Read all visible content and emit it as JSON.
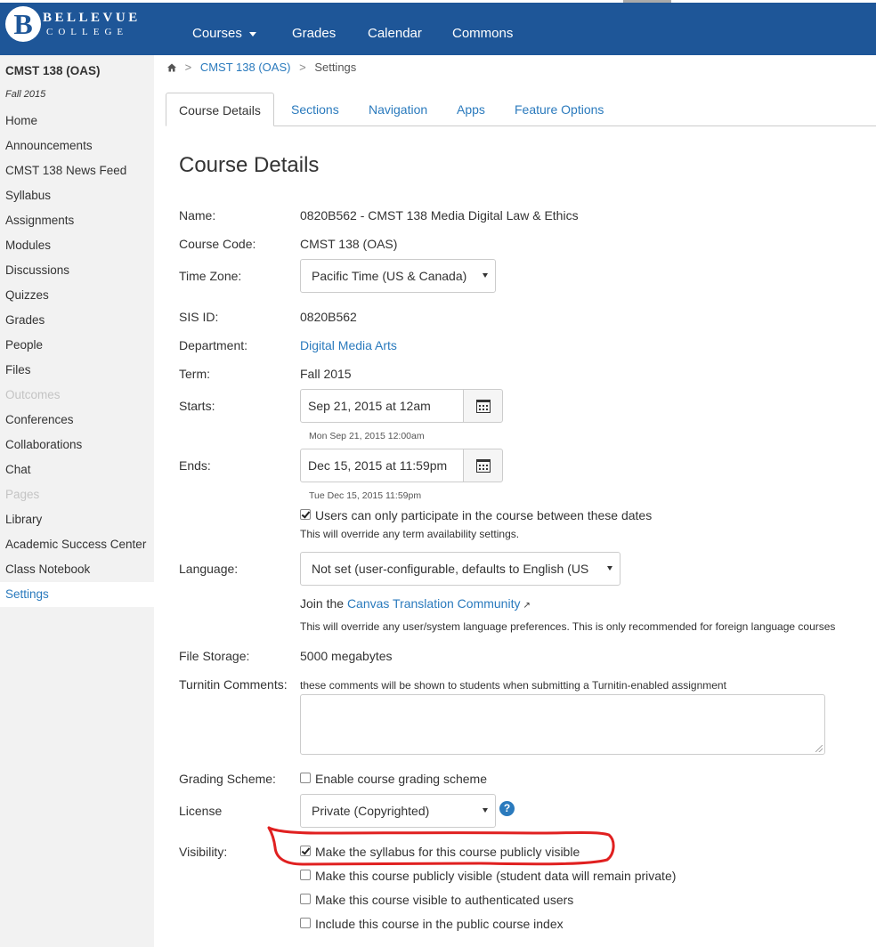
{
  "header": {
    "logo_letter": "B",
    "logo_line1": "BELLEVUE",
    "logo_line2": "COLLEGE",
    "nav": {
      "courses": "Courses",
      "grades": "Grades",
      "calendar": "Calendar",
      "commons": "Commons"
    }
  },
  "sidebar": {
    "course_title": "CMST 138 (OAS)",
    "term": "Fall 2015",
    "items": [
      {
        "label": "Home",
        "state": "normal"
      },
      {
        "label": "Announcements",
        "state": "normal"
      },
      {
        "label": "CMST 138 News Feed",
        "state": "normal"
      },
      {
        "label": "Syllabus",
        "state": "normal"
      },
      {
        "label": "Assignments",
        "state": "normal"
      },
      {
        "label": "Modules",
        "state": "normal"
      },
      {
        "label": "Discussions",
        "state": "normal"
      },
      {
        "label": "Quizzes",
        "state": "normal"
      },
      {
        "label": "Grades",
        "state": "normal"
      },
      {
        "label": "People",
        "state": "normal"
      },
      {
        "label": "Files",
        "state": "normal"
      },
      {
        "label": "Outcomes",
        "state": "disabled"
      },
      {
        "label": "Conferences",
        "state": "normal"
      },
      {
        "label": "Collaborations",
        "state": "normal"
      },
      {
        "label": "Chat",
        "state": "normal"
      },
      {
        "label": "Pages",
        "state": "disabled"
      },
      {
        "label": "Library",
        "state": "normal"
      },
      {
        "label": "Academic Success Center",
        "state": "normal"
      },
      {
        "label": "Class Notebook",
        "state": "normal"
      },
      {
        "label": "Settings",
        "state": "active"
      }
    ]
  },
  "breadcrumb": {
    "course": "CMST 138 (OAS)",
    "current": "Settings"
  },
  "tabs": {
    "course_details": "Course Details",
    "sections": "Sections",
    "navigation": "Navigation",
    "apps": "Apps",
    "feature_options": "Feature Options"
  },
  "form": {
    "title": "Course Details",
    "name_label": "Name:",
    "name_value": "0820B562 - CMST 138 Media Digital Law & Ethics",
    "code_label": "Course Code:",
    "code_value": "CMST 138 (OAS)",
    "tz_label": "Time Zone:",
    "tz_value": "Pacific Time (US & Canada)",
    "sis_label": "SIS ID:",
    "sis_value": "0820B562",
    "dept_label": "Department:",
    "dept_value": "Digital Media Arts",
    "term_label": "Term:",
    "term_value": "Fall 2015",
    "starts_label": "Starts:",
    "starts_value": "Sep 21, 2015 at 12am",
    "starts_hint": "Mon Sep 21, 2015 12:00am",
    "ends_label": "Ends:",
    "ends_value": "Dec 15, 2015 at 11:59pm",
    "ends_hint": "Tue Dec 15, 2015 11:59pm",
    "restrict_label": "Users can only participate in the course between these dates",
    "restrict_checked": true,
    "restrict_note": "This will override any term availability settings.",
    "lang_label": "Language:",
    "lang_value": "Not set (user-configurable, defaults to English (US",
    "join_text": "Join the",
    "join_link": "Canvas Translation Community",
    "lang_note": "This will override any user/system language preferences. This is only recommended for foreign language courses",
    "storage_label": "File Storage:",
    "storage_value": "5000 megabytes",
    "turnitin_label": "Turnitin Comments:",
    "turnitin_note": "these comments will be shown to students when submitting a Turnitin-enabled assignment",
    "grading_label": "Grading Scheme:",
    "grading_cb": "Enable course grading scheme",
    "grading_checked": false,
    "license_label": "License",
    "license_value": "Private (Copyrighted)",
    "help_glyph": "?",
    "visibility_label": "Visibility:",
    "visibility_options": [
      {
        "label": "Make the syllabus for this course publicly visible",
        "checked": true
      },
      {
        "label": "Make this course publicly visible (student data will remain private)",
        "checked": false
      },
      {
        "label": "Make this course visible to authenticated users",
        "checked": false
      },
      {
        "label": "Include this course in the public course index",
        "checked": false
      }
    ]
  },
  "annotation_color": "#e02020"
}
